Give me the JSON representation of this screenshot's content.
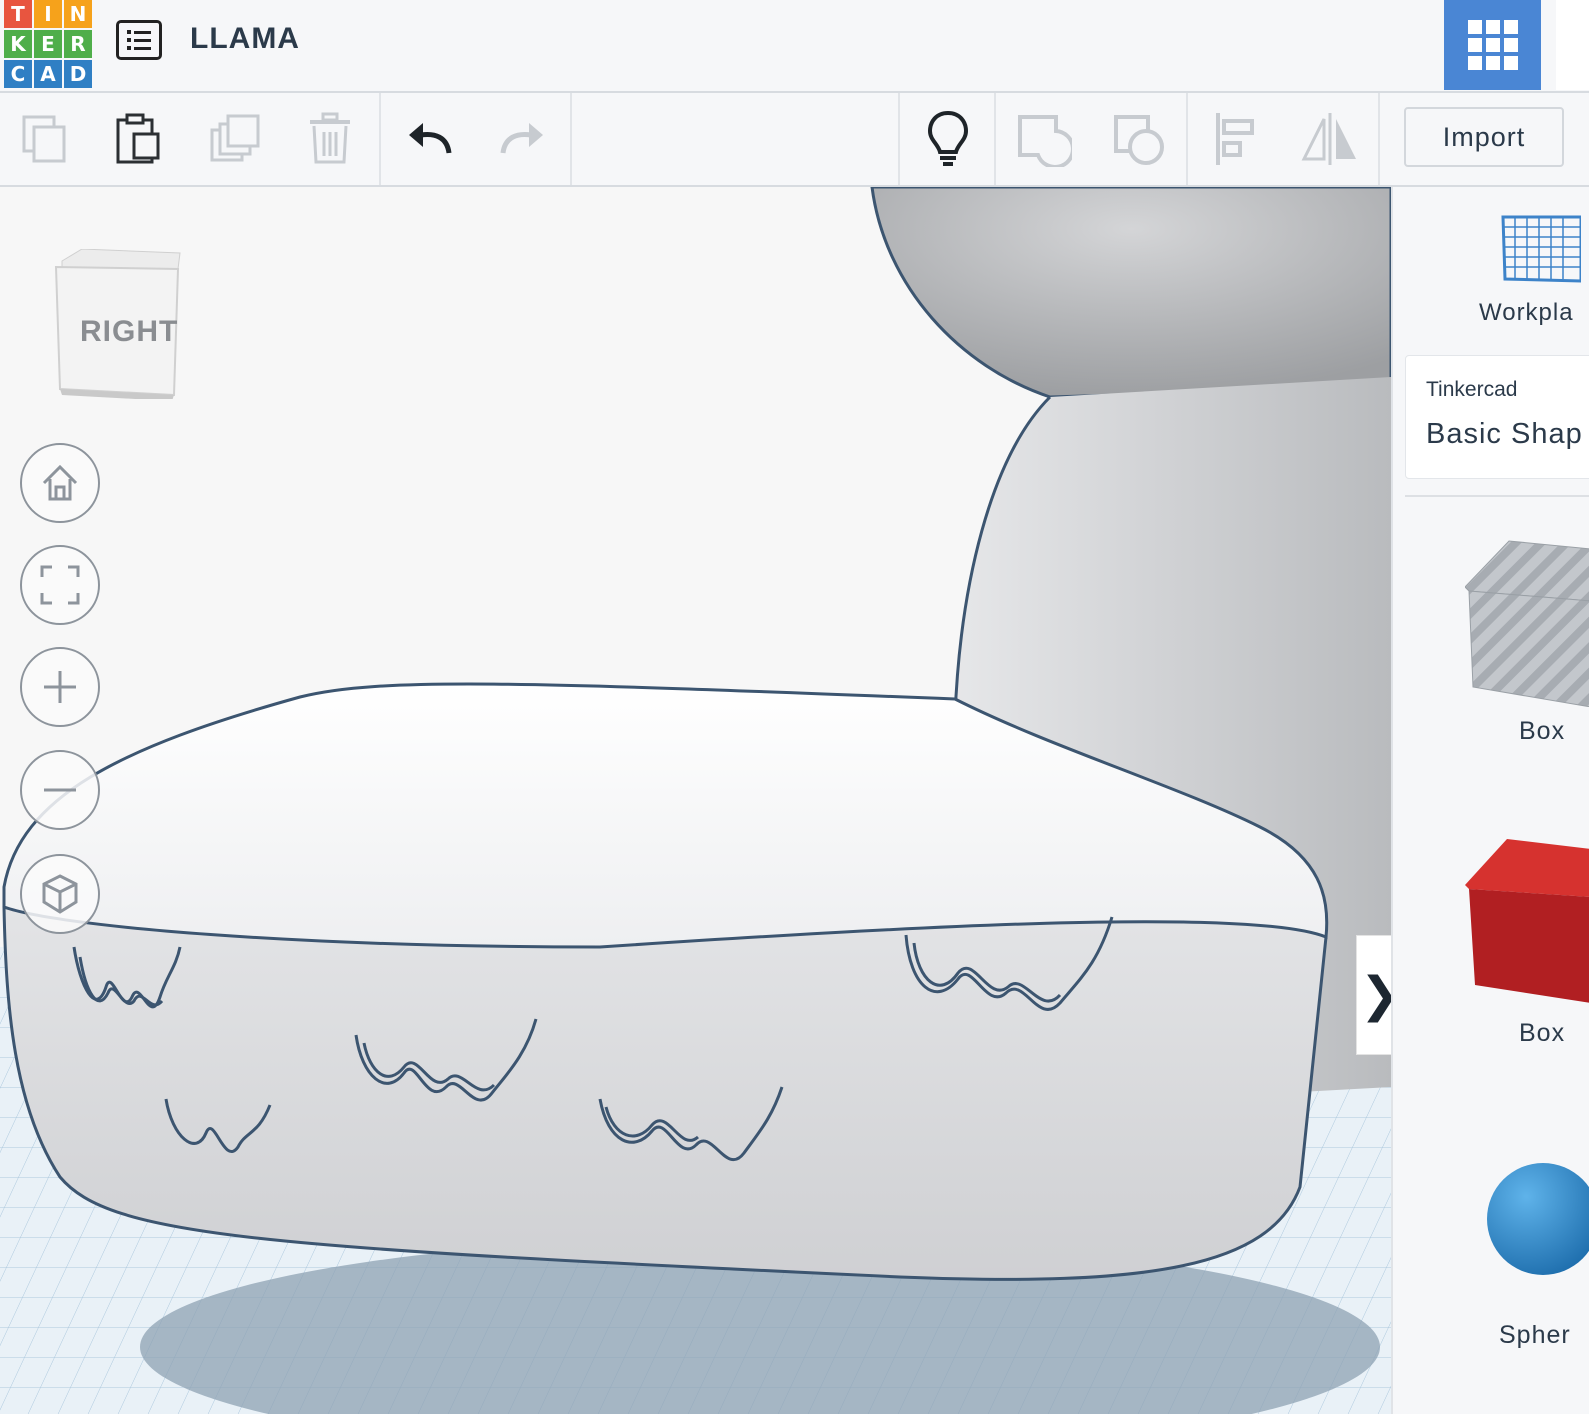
{
  "app": {
    "logo_letters": [
      "T",
      "I",
      "N",
      "K",
      "E",
      "R",
      "C",
      "A",
      "D"
    ],
    "project_title": "LLAMA"
  },
  "toolbar": {
    "copy_icon": "copy-icon",
    "paste_icon": "paste-icon",
    "duplicate_icon": "duplicate-icon",
    "delete_icon": "trash-icon",
    "undo_icon": "undo-icon",
    "redo_icon": "redo-icon",
    "notes_icon": "lightbulb-icon",
    "group_icon": "group-icon",
    "ungroup_icon": "ungroup-icon",
    "align_icon": "align-icon",
    "mirror_icon": "mirror-icon",
    "import_label": "Import"
  },
  "viewport": {
    "viewcube_face": "RIGHT",
    "nav_controls": [
      "home-icon",
      "fit-icon",
      "zoom-in-icon",
      "zoom-out-icon",
      "perspective-icon"
    ],
    "collapse_arrow": "❯"
  },
  "panel": {
    "workplane_label": "Workpla",
    "library_source": "Tinkercad",
    "library_name": "Basic Shap",
    "shapes": [
      {
        "label": "Box",
        "color": "#bfc4ca"
      },
      {
        "label": "Box",
        "color": "#c8262a"
      },
      {
        "label": "Spher",
        "color": "#2f8fd0"
      }
    ]
  },
  "colors": {
    "accent": "#4a86d4",
    "shape_outline": "#3c5570",
    "grid": "#a9c6dc"
  }
}
